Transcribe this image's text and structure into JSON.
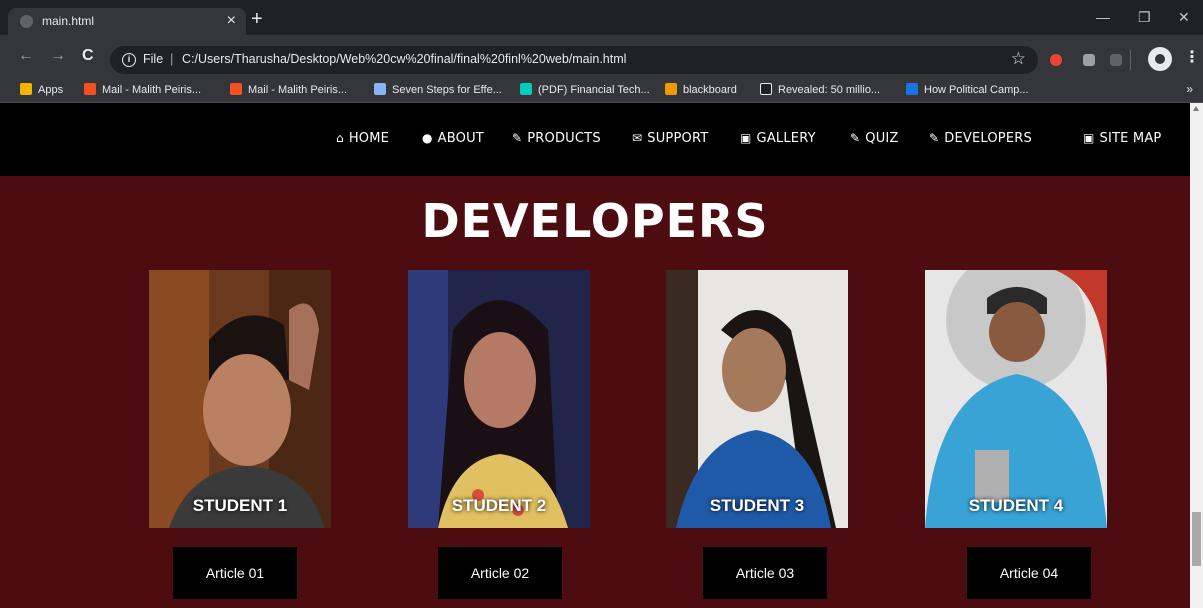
{
  "browser": {
    "tab_title": "main.html",
    "tab_close": "×",
    "new_tab": "+",
    "window": {
      "minimize": "—",
      "restore": "❐",
      "close": "✕"
    },
    "nav": {
      "back": "←",
      "forward": "→",
      "reload": "C"
    },
    "address": {
      "info": "i",
      "label": "File",
      "separator": "|",
      "url": "C:/Users/Tharusha/Desktop/Web%20cw%20final/final%20finl%20web/main.html",
      "bookmark_star": "☆"
    },
    "menu": "⋮",
    "bookmarks": [
      {
        "label": "Apps",
        "color": "#f4b400"
      },
      {
        "label": "Mail - Malith Peiris...",
        "color": "#f25022"
      },
      {
        "label": "Mail - Malith Peiris...",
        "color": "#f25022"
      },
      {
        "label": "Seven Steps for Effe...",
        "color": "#8ab4f8"
      },
      {
        "label": "(PDF) Financial Tech...",
        "color": "#00ccbb"
      },
      {
        "label": "blackboard",
        "color": "#f29900"
      },
      {
        "label": "Revealed: 50 millio...",
        "color": "#202124"
      },
      {
        "label": "How Political Camp...",
        "color": "#1a73e8"
      }
    ],
    "bookmarks_more": "»"
  },
  "site": {
    "nav": [
      {
        "icon": "⌂",
        "label": "HOME"
      },
      {
        "icon": "●",
        "label": "ABOUT"
      },
      {
        "icon": "✎",
        "label": "PRODUCTS"
      },
      {
        "icon": "✉",
        "label": "SUPPORT"
      },
      {
        "icon": "▣",
        "label": "GALLERY"
      },
      {
        "icon": "✎",
        "label": "QUIZ"
      },
      {
        "icon": "✎",
        "label": "DEVELOPERS"
      },
      {
        "icon": "▣",
        "label": "SITE MAP"
      }
    ],
    "title": "DEVELOPERS",
    "developers": [
      {
        "caption": "STUDENT 1",
        "article": "Article 01"
      },
      {
        "caption": "STUDENT 2",
        "article": "Article 02"
      },
      {
        "caption": "STUDENT 3",
        "article": "Article 03"
      },
      {
        "caption": "STUDENT 4",
        "article": "Article 04"
      }
    ]
  },
  "colors": {
    "page_background": "#4d0c0f",
    "navbar_background": "#000000",
    "button_background": "#000000",
    "text": "#ffffff"
  }
}
